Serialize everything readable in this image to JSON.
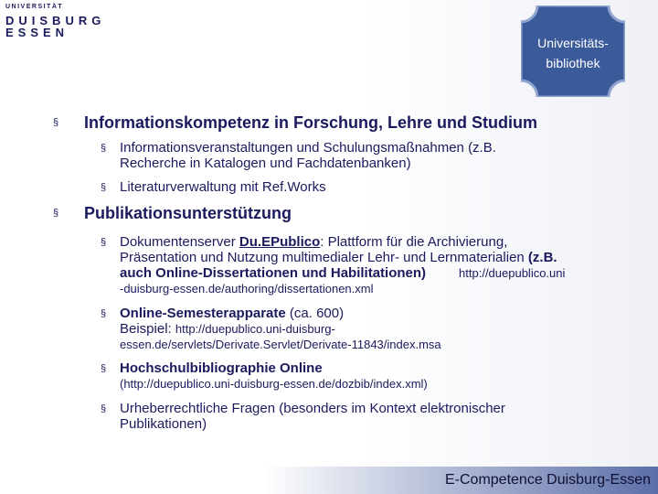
{
  "logo": {
    "line1": "UNIVERSITÄT",
    "line2": "DUISBURG",
    "line3": "ESSEN"
  },
  "badge": {
    "line1": "Universitäts-",
    "line2": "bibliothek",
    "color": "#3a5a9a"
  },
  "bullets": [
    {
      "title": "Informationskompetenz in Forschung, Lehre und Studium",
      "sub": [
        {
          "line1": "Informationsveranstaltungen und Schulungsmaßnahmen (z.B.",
          "line2": "Recherche in Katalogen und Fachdatenbanken)"
        },
        {
          "line1": "Literaturverwaltung mit Ref.Works"
        }
      ]
    },
    {
      "title": "Publikationsunterstützung",
      "sub": [
        {
          "p1": "Dokumentenserver ",
          "p2": "Du.EPublico",
          "p3": ": Plattform für die Archivierung,",
          "line2": "Präsentation und Nutzung multimedialer Lehr- und Lernmaterialien ",
          "line2b": "(z.B.",
          "line3": "auch Online-Dissertationen und Habilitationen)",
          "url1": "http://duepublico.uni",
          "url2": "-duisburg-essen.de/authoring/dissertationen.xml"
        },
        {
          "p1": "Online-Semesterapparate",
          "p2": " (ca. 600)",
          "line2a": "Beispiel: ",
          "line2b": "http://duepublico.uni-duisburg-",
          "line3": "essen.de/servlets/Derivate.Servlet/Derivate-11843/index.msa"
        },
        {
          "p1": "Hochschulbibliographie Online",
          "line2": "(http://duepublico.uni-duisburg-essen.de/dozbib/index.xml)"
        },
        {
          "line1": "Urheberrechtliche Fragen (besonders im Kontext elektronischer",
          "line2": "Publikationen)"
        }
      ]
    }
  ],
  "footer": {
    "text": "E-Competence Duisburg-Essen"
  },
  "bullet_char": "§"
}
